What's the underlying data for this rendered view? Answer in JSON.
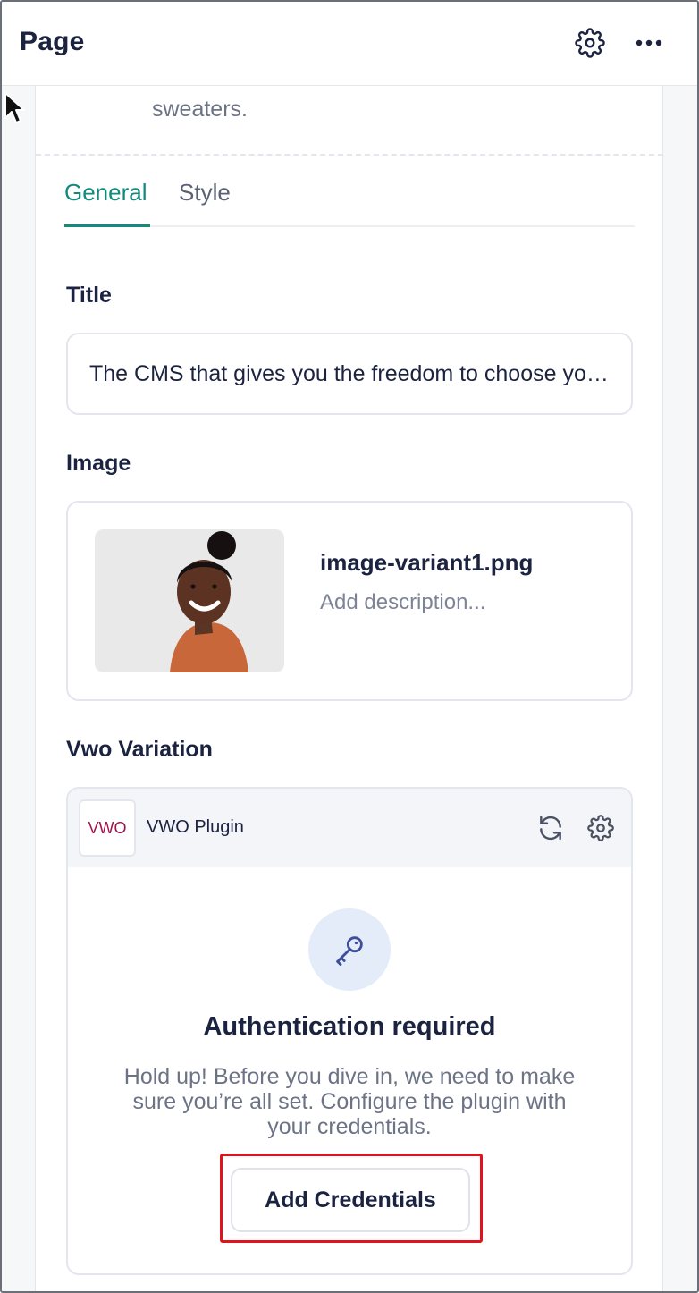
{
  "header": {
    "title": "Page"
  },
  "previous_text": "choose your own tech stack and wear bright sweaters.",
  "tabs": [
    {
      "label": "General",
      "active": true
    },
    {
      "label": "Style",
      "active": false
    }
  ],
  "fields": {
    "title": {
      "label": "Title",
      "value": "The CMS that gives you the freedom to choose your own tech stack and wear bright sweaters."
    },
    "image": {
      "label": "Image",
      "file_name": "image-variant1.png",
      "description_placeholder": "Add description..."
    },
    "vwo": {
      "label": "Vwo Variation",
      "plugin_name": "VWO Plugin",
      "logo_text": "VWO",
      "auth_title": "Authentication required",
      "auth_text": "Hold up! Before you dive in, we need to make sure you’re all set. Configure the plugin with your credentials.",
      "button_label": "Add Credentials"
    }
  },
  "colors": {
    "accent": "#138a7e",
    "text": "#1c2340",
    "muted": "#6b7385",
    "highlight": "#e0141e",
    "key_bg": "#e4ebf9",
    "vwo_brand": "#a0144f"
  },
  "icons": {
    "header_settings": "gear-icon",
    "header_more": "more-horizontal-icon",
    "vwo_refresh": "refresh-icon",
    "vwo_settings": "gear-icon",
    "auth": "key-icon",
    "pointer": "cursor-arrow-icon"
  }
}
